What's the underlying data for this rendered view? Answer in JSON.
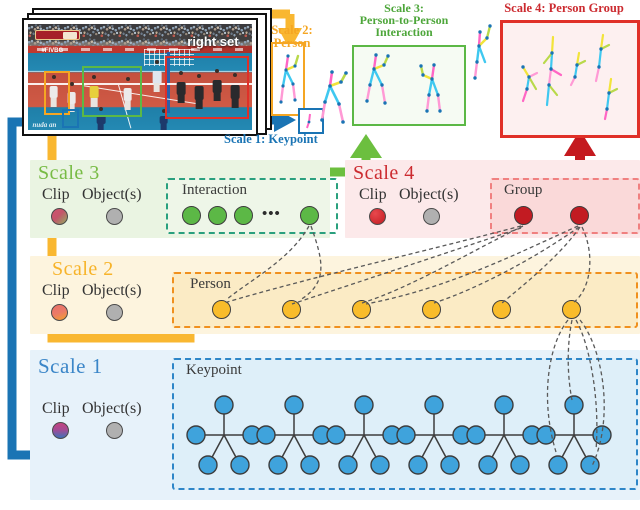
{
  "figure": {
    "caption_in_video": "right set",
    "video_watermark": "nuda an",
    "ad_text": "#FIVBG"
  },
  "arrow_titles": {
    "scale2": "Scale 2:\nPerson",
    "scale1": "Scale 1: Keypoint",
    "scale3": "Scale 3:\nPerson-to-Person\nInteraction",
    "scale4": "Scale 4: Person Group",
    "scale2_line1": "Scale 2:",
    "scale2_line2": "Person",
    "scale3_line1": "Scale 3:",
    "scale3_line2": "Person-to-Person",
    "scale3_line3": "Interaction",
    "scale1_label": "Scale 1: Keypoint",
    "scale4_label": "Scale 4: Person Group"
  },
  "panels": [
    {
      "id": "scale3",
      "title": "Scale 3",
      "title_color": "#77bb44",
      "bg": "#eaf4e2",
      "clip_label": "Clip",
      "object_label": "Object(s)",
      "clip_dot_color": "#c4556a",
      "object_dot_color": "#b0b0b0",
      "group_label": "Interaction",
      "group_box_color": "#2aa07e",
      "node_color": "#5cb846",
      "node_count": 4,
      "has_ellipsis": true,
      "ellipsis": "•••"
    },
    {
      "id": "scale4",
      "title": "Scale 4",
      "title_color": "#cc2b30",
      "bg": "#fce9ea",
      "clip_label": "Clip",
      "object_label": "Object(s)",
      "clip_dot_color": "#cf1f26",
      "object_dot_color": "#b0b0b0",
      "group_label": "Group",
      "group_box_color": "#f08080",
      "node_color": "#c21b22",
      "node_count": 2,
      "has_ellipsis": false,
      "ellipsis": ""
    },
    {
      "id": "scale2",
      "title": "Scale 2",
      "title_color": "#f7b329",
      "bg": "#fdf4de",
      "clip_label": "Clip",
      "object_label": "Object(s)",
      "clip_dot_color": "#e8726a",
      "object_dot_color": "#b0b0b0",
      "group_label": "Person",
      "group_box_color": "#f0901e",
      "node_color": "#f9bc2b",
      "node_count": 6,
      "has_ellipsis": false,
      "ellipsis": ""
    },
    {
      "id": "scale1",
      "title": "Scale 1",
      "title_color": "#3b86c8",
      "bg": "#e7f2fa",
      "clip_label": "Clip",
      "object_label": "Object(s)",
      "clip_dot_color": "#b0407a",
      "object_dot_color": "#b0b0b0",
      "group_label": "Keypoint",
      "group_box_color": "#2e86c8",
      "node_color": "#3fa3dc",
      "node_count": 6,
      "has_ellipsis": false,
      "ellipsis": ""
    }
  ],
  "colors": {
    "scale1_blue": "#1a74b4",
    "scale2_orange": "#f9b731",
    "scale3_green": "#6cbf3f",
    "scale4_red": "#c4191f",
    "dashed_gray": "#595959"
  },
  "detection_boxes": [
    {
      "name": "person-box-orange",
      "color": "#f5a623"
    },
    {
      "name": "keypoint-box-blue",
      "color": "#1a74b4"
    },
    {
      "name": "interaction-box-green",
      "color": "#5cb846"
    },
    {
      "name": "group-box-red",
      "color": "#e03028"
    }
  ]
}
